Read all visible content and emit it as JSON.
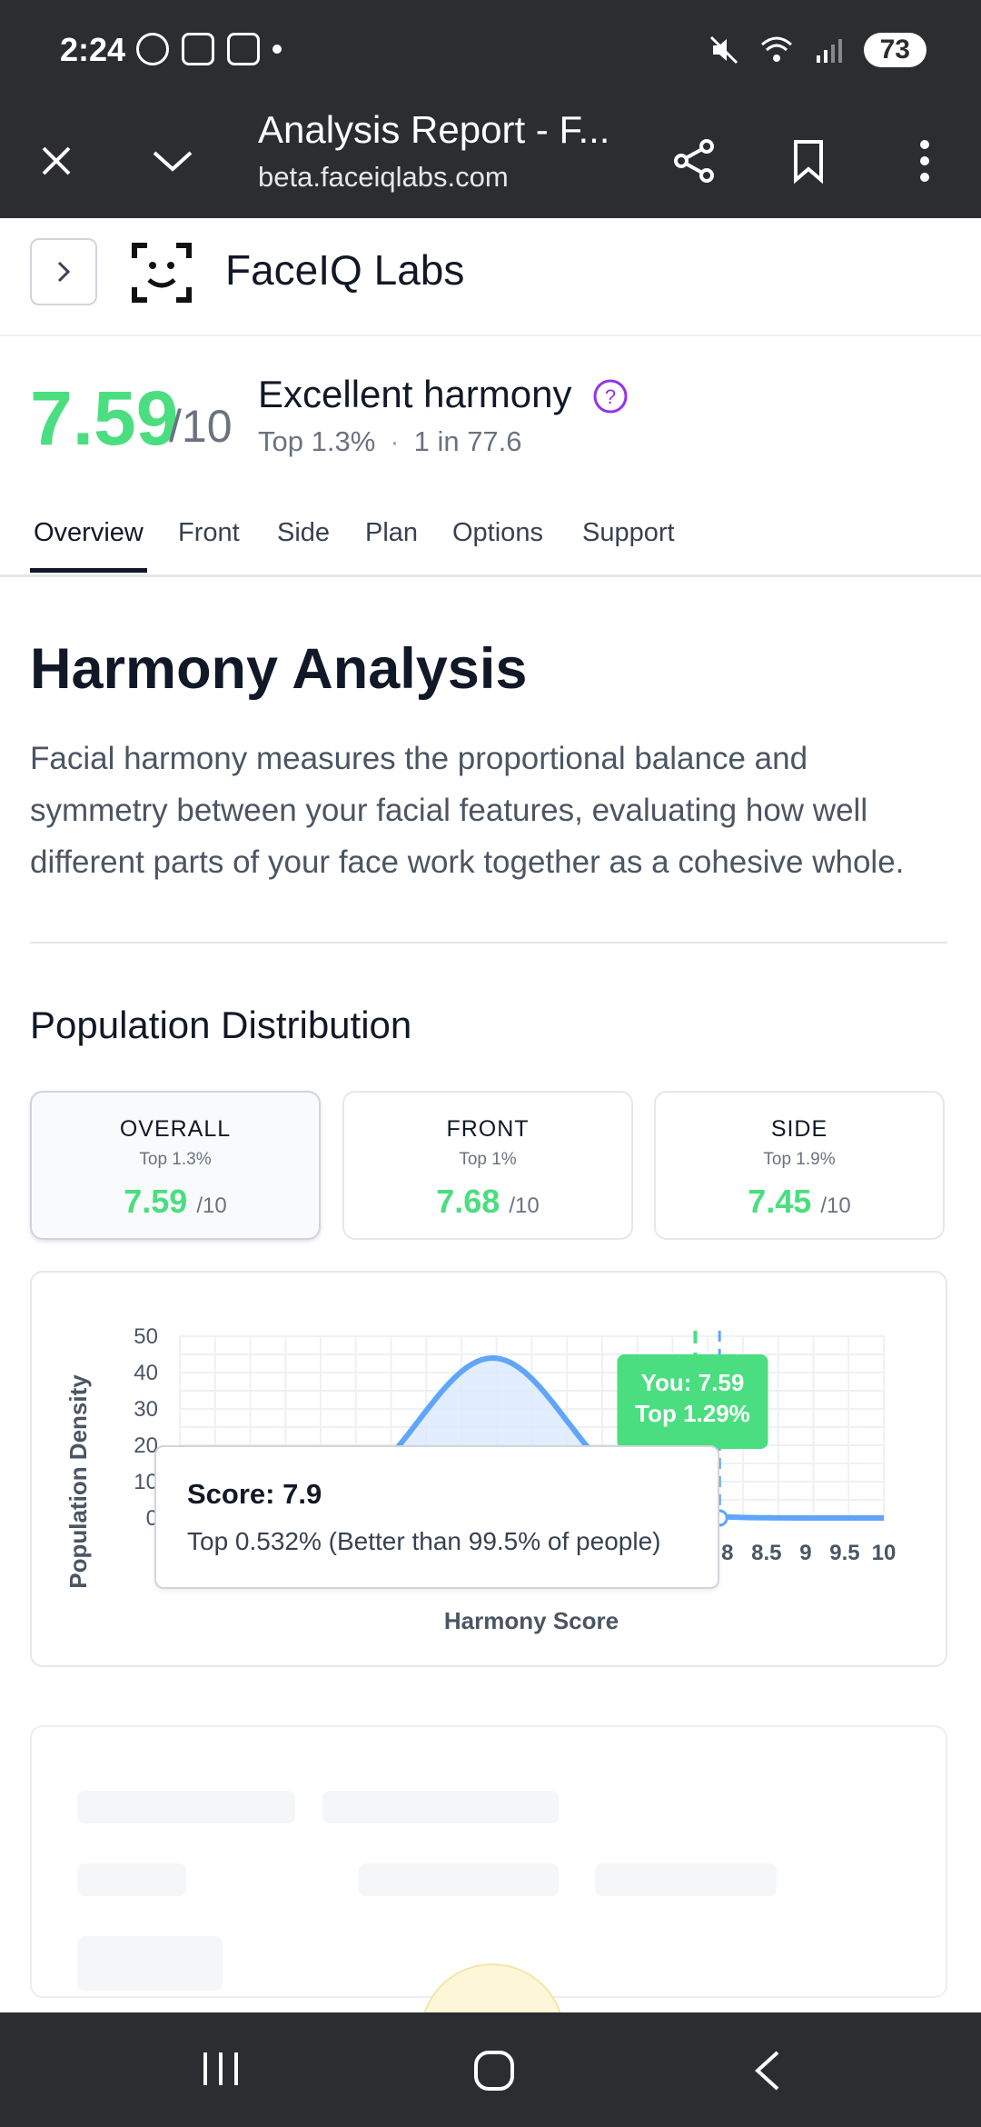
{
  "status_bar": {
    "time": "2:24",
    "battery": "73",
    "icons_left": [
      "data-saver-icon",
      "bag-icon",
      "screenshot-icon",
      "dot-icon"
    ],
    "icons_right": [
      "mute-icon",
      "wifi-icon",
      "signal-icon",
      "battery-icon"
    ]
  },
  "browser": {
    "title": "Analysis Report - F...",
    "url": "beta.faceiqlabs.com",
    "buttons": [
      "close-icon",
      "chevron-down-icon",
      "share-icon",
      "bookmark-icon",
      "more-vert-icon"
    ]
  },
  "site": {
    "brand": "FaceIQ Labs"
  },
  "summary": {
    "score": "7.59",
    "denom": "/10",
    "label": "Excellent harmony",
    "top": "Top 1.3%",
    "sep": "·",
    "ratio": "1 in 77.6"
  },
  "tabs": [
    "Overview",
    "Front",
    "Side",
    "Plan",
    "Options",
    "Support"
  ],
  "section": {
    "title": "Harmony Analysis",
    "description": "Facial harmony measures the proportional balance and symmetry between your facial features, evaluating how well different parts of your face work together as a cohesive whole.",
    "subtitle": "Population Distribution"
  },
  "cards": [
    {
      "title": "OVERALL",
      "top": "Top 1.3%",
      "score": "7.59",
      "denom": "/10"
    },
    {
      "title": "FRONT",
      "top": "Top 1%",
      "score": "7.68",
      "denom": "/10"
    },
    {
      "title": "SIDE",
      "top": "Top 1.9%",
      "score": "7.45",
      "denom": "/10"
    }
  ],
  "chart_data": {
    "type": "area",
    "xlabel": "Harmony Score",
    "ylabel": "Population Density",
    "ylim": [
      0,
      50
    ],
    "xlim": [
      1,
      10
    ],
    "y_ticks": [
      "0",
      "10",
      "20",
      "30",
      "40",
      "50"
    ],
    "x_ticks_visible": [
      "8",
      "8.5",
      "9",
      "9.5",
      "10"
    ],
    "peak": {
      "x": 5.0,
      "y": 44
    },
    "you_marker": {
      "x": 7.59,
      "label1": "You: 7.59",
      "label2": "Top 1.29%"
    },
    "hover_marker": {
      "x": 7.9,
      "y": 0
    },
    "grid": true,
    "color": "#60a5fa",
    "marker_color": "#4ade80"
  },
  "tooltip": {
    "title": "Score: 7.9",
    "body": "Top 0.532% (Better than 99.5% of people)"
  }
}
